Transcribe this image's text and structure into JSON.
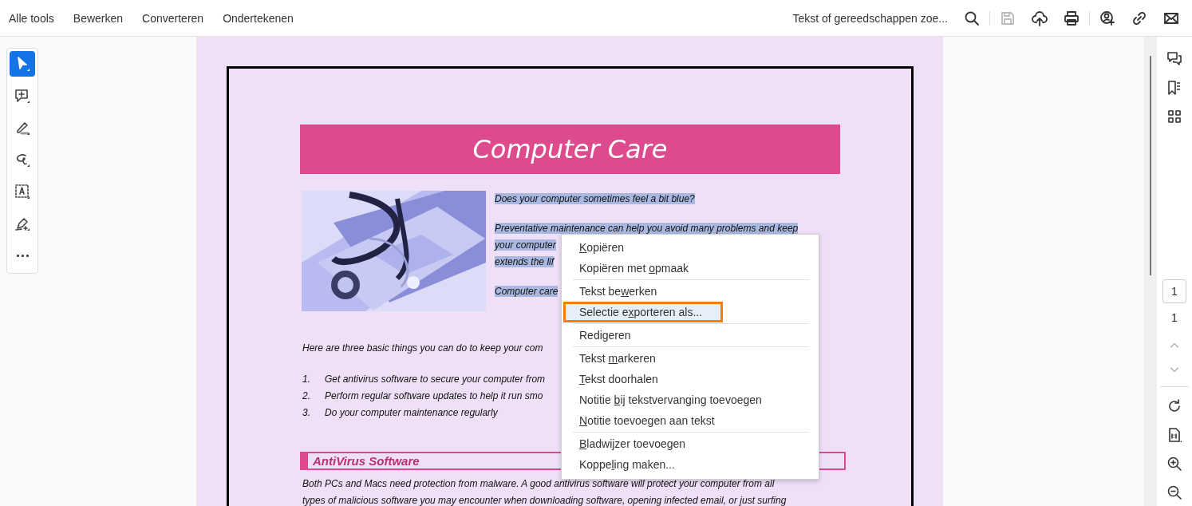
{
  "top_menu": [
    {
      "label": "Alle tools"
    },
    {
      "label": "Bewerken"
    },
    {
      "label": "Converteren"
    },
    {
      "label": "Ondertekenen"
    }
  ],
  "search": {
    "label": "Tekst of gereedschappen zoe..."
  },
  "toolbar_actions": [
    {
      "kind": "search",
      "disabled": false
    },
    {
      "kind": "divider"
    },
    {
      "kind": "save",
      "disabled": true
    },
    {
      "kind": "upload",
      "disabled": false
    },
    {
      "kind": "print",
      "disabled": false
    },
    {
      "kind": "divider"
    },
    {
      "kind": "share",
      "disabled": false
    },
    {
      "kind": "link",
      "disabled": false
    },
    {
      "kind": "mail",
      "disabled": false
    }
  ],
  "tools": [
    {
      "kind": "select",
      "selected": true
    },
    {
      "kind": "comment",
      "selected": false
    },
    {
      "kind": "highlight",
      "selected": false
    },
    {
      "kind": "draw",
      "selected": false
    },
    {
      "kind": "textbox",
      "selected": false
    },
    {
      "kind": "sign",
      "selected": false
    },
    {
      "kind": "more",
      "selected": false
    }
  ],
  "document": {
    "title": "Computer Care",
    "intro": [
      {
        "lines": [
          "Does your computer sometimes feel a bit blue?"
        ],
        "selected": true
      },
      {
        "lines": [
          "Preventative maintenance can help you avoid many problems and keep",
          "your computer",
          "extends the lif"
        ],
        "selected": true
      },
      {
        "lines": [
          "Computer care"
        ],
        "selected": true
      }
    ],
    "lead": "Here are three basic things you can do to keep your com",
    "steps": [
      {
        "number": "1.",
        "text": "Get antivirus software to secure your computer from"
      },
      {
        "number": "2.",
        "text": "Perform regular software updates to help it run smo"
      },
      {
        "number": "3.",
        "text": "Do your computer maintenance regularly"
      }
    ],
    "section_heading": "AntiVirus Software",
    "body_lines": [
      "Both PCs and Macs need protection from malware.  A good antivirus software will protect your computer from all",
      "types of malicious software you may encounter when downloading software, opening infected email, or just surfing"
    ]
  },
  "context_menu": {
    "groups": [
      [
        {
          "key": "K",
          "post": "opiëren",
          "selected": false
        },
        {
          "pre": "Kopiëren met ",
          "key": "o",
          "post": "pmaak",
          "selected": false
        }
      ],
      [
        {
          "pre": "Tekst be",
          "key": "w",
          "post": "erken",
          "selected": false
        },
        {
          "pre": "Selectie e",
          "key": "x",
          "post": "porteren als...",
          "selected": true
        }
      ],
      [
        {
          "pre": "Redigeren",
          "selected": false
        }
      ],
      [
        {
          "pre": "Tekst ",
          "key": "m",
          "post": "arkeren",
          "selected": false
        },
        {
          "key": "T",
          "post": "ekst doorhalen",
          "selected": false
        },
        {
          "pre": "Notitie ",
          "key": "b",
          "post": "ij tekstvervanging toevoegen",
          "selected": false
        },
        {
          "key": "N",
          "post": "otitie toevoegen aan tekst",
          "selected": false
        }
      ],
      [
        {
          "key": "B",
          "post": "ladwijzer toevoegen",
          "selected": false
        },
        {
          "pre": "Koppe",
          "key": "l",
          "post": "ing maken...",
          "selected": false
        }
      ]
    ]
  },
  "right_rail": {
    "top": [
      {
        "kind": "comments"
      },
      {
        "kind": "bookmarks"
      },
      {
        "kind": "thumbnails"
      }
    ],
    "page_input": "1",
    "page_count": "1",
    "nav": [
      {
        "kind": "up",
        "disabled": true
      },
      {
        "kind": "down",
        "disabled": true
      }
    ],
    "bottom": [
      {
        "kind": "rotate"
      },
      {
        "kind": "actual-size"
      },
      {
        "kind": "zoom-in"
      },
      {
        "kind": "zoom-out"
      }
    ]
  }
}
